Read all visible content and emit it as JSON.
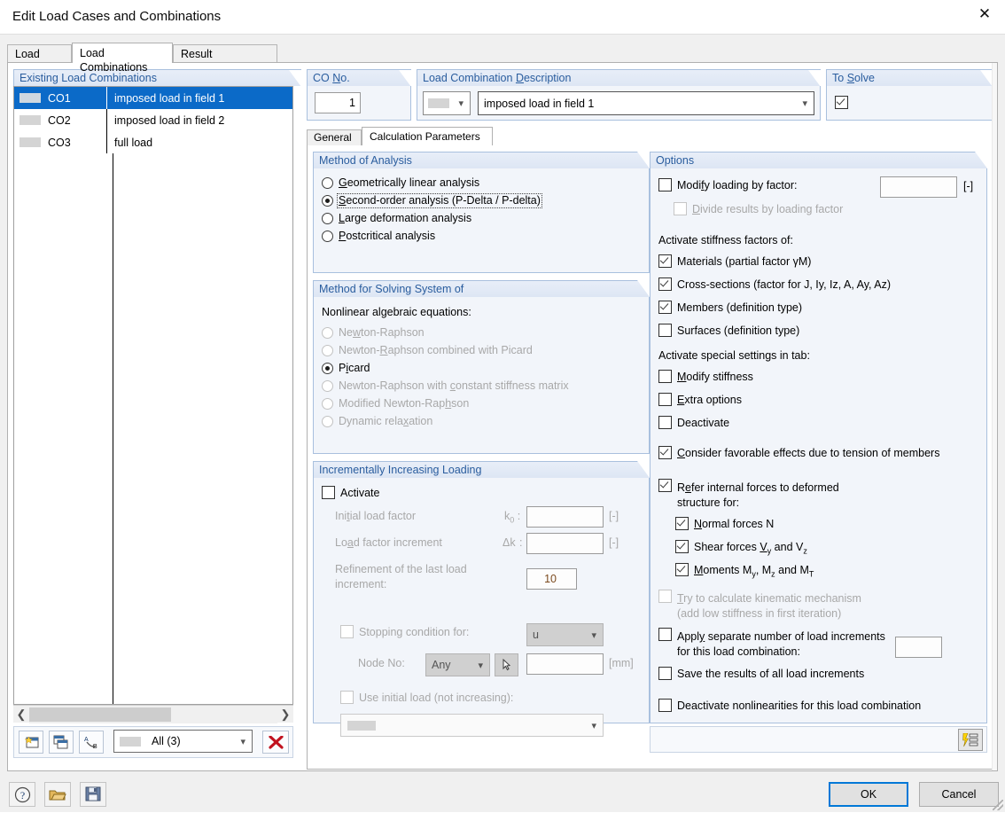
{
  "window": {
    "title": "Edit Load Cases and Combinations",
    "close_icon": "close-icon"
  },
  "tabs": [
    {
      "label": "Load Cases",
      "active": false
    },
    {
      "label": "Load Combinations",
      "active": true
    },
    {
      "label": "Result Combinations",
      "active": false
    }
  ],
  "existing": {
    "title": "Existing Load Combinations",
    "rows": [
      {
        "no": "CO1",
        "desc": "imposed load in field 1",
        "selected": true
      },
      {
        "no": "CO2",
        "desc": "imposed load in field 2",
        "selected": false
      },
      {
        "no": "CO3",
        "desc": "full load",
        "selected": false
      }
    ],
    "filter_value": "All (3)",
    "toolbar": {
      "new_icon": "new-combination-icon",
      "copy_icon": "copy-combination-icon",
      "renumber_icon": "renumber-icon",
      "delete_icon": "delete-red-x-icon"
    }
  },
  "co_no": {
    "title": "CO No.",
    "title_mnemonic": "N",
    "value": "1"
  },
  "description": {
    "title": "Load Combination Description",
    "title_mnemonic": "D",
    "value": "imposed load in field 1",
    "color_swatch": "#d4d4d4"
  },
  "to_solve": {
    "title": "To Solve",
    "title_mnemonic": "S",
    "checked": true
  },
  "inner_tabs": [
    {
      "label": "General",
      "active": false
    },
    {
      "label": "Calculation Parameters",
      "active": true
    }
  ],
  "method_of_analysis": {
    "title": "Method of Analysis",
    "options": [
      {
        "label": "Geometrically linear analysis",
        "mnemonic": "G",
        "selected": false,
        "focused": false
      },
      {
        "label": "Second-order analysis (P-Delta / P-delta)",
        "mnemonic": "S",
        "selected": true,
        "focused": true
      },
      {
        "label": "Large deformation analysis",
        "mnemonic": "L",
        "selected": false,
        "focused": false
      },
      {
        "label": "Postcritical analysis",
        "mnemonic": "P",
        "selected": false,
        "focused": false
      }
    ]
  },
  "method_solving": {
    "title": "Method for Solving System of",
    "subtitle": "Nonlinear algebraic equations:",
    "options": [
      {
        "label": "Newton-Raphson",
        "selected": false,
        "disabled": true
      },
      {
        "label": "Newton-Raphson combined with Picard",
        "selected": false,
        "disabled": true
      },
      {
        "label": "Picard",
        "selected": true,
        "disabled": false
      },
      {
        "label": "Newton-Raphson with constant stiffness matrix",
        "selected": false,
        "disabled": true
      },
      {
        "label": "Modified Newton-Raphson",
        "selected": false,
        "disabled": true
      },
      {
        "label": "Dynamic relaxation",
        "selected": false,
        "disabled": true
      }
    ]
  },
  "incremental": {
    "title": "Incrementally Increasing Loading",
    "activate": {
      "label": "Activate",
      "checked": false
    },
    "initial_load_factor": {
      "label": "Initial load factor",
      "symbol": "k",
      "symbol_sub": "0",
      "value": "",
      "unit": "[-]"
    },
    "load_factor_increment": {
      "label": "Load factor increment",
      "symbol": "Δk",
      "value": "",
      "unit": "[-]"
    },
    "refinement": {
      "label": "Refinement of the last load increment:",
      "value": "10"
    },
    "stopping_condition": {
      "label": "Stopping condition for:",
      "checked": false,
      "select_value": "u"
    },
    "node_no": {
      "label": "Node No:",
      "select_value": "Any",
      "pick_icon": "pick-node-icon",
      "value": "",
      "unit": "[mm]"
    },
    "use_initial_load": {
      "label": "Use initial load (not increasing):",
      "checked": false,
      "select_value": ""
    }
  },
  "options": {
    "title": "Options",
    "modify_loading": {
      "label": "Modify loading by factor:",
      "mnemonic": "f",
      "checked": false,
      "value": "",
      "unit": "[-]"
    },
    "divide_results": {
      "label": "Divide results by loading factor",
      "mnemonic": "D",
      "checked": false,
      "disabled": true
    },
    "stiffness_header": "Activate stiffness factors of:",
    "stiffness": [
      {
        "label": "Materials (partial factor γM)",
        "checked": true
      },
      {
        "label": "Cross-sections (factor for J, Iy, Iz, A, Ay, Az)",
        "checked": true
      },
      {
        "label": "Members (definition type)",
        "checked": true
      },
      {
        "label": "Surfaces (definition type)",
        "checked": false
      }
    ],
    "special_header": "Activate special settings in tab:",
    "special": [
      {
        "label": "Modify stiffness",
        "mnemonic": "M",
        "checked": false
      },
      {
        "label": "Extra options",
        "mnemonic": "E",
        "checked": false
      },
      {
        "label": "Deactivate",
        "checked": false
      }
    ],
    "favorable": {
      "label": "Consider favorable effects due to tension of members",
      "mnemonic": "C",
      "checked": true
    },
    "refer_internal": {
      "label_line1": "Refer internal forces to deformed",
      "label_line2": "structure for:",
      "checked": true
    },
    "refer_sub": [
      {
        "label": "Normal forces N",
        "checked": true
      },
      {
        "label": "Shear forces Vy and Vz",
        "checked": true
      },
      {
        "label": "Moments My, Mz and MT",
        "checked": true
      }
    ],
    "kinematic": {
      "label_line1": "Try to calculate kinematic mechanism",
      "label_line2": "(add low stiffness in first iteration)",
      "checked": false,
      "disabled": true
    },
    "separate_increments": {
      "label_line1": "Apply separate number of load increments",
      "label_line2": "for this load combination:",
      "checked": false,
      "value": ""
    },
    "save_results": {
      "label": "Save the results of all load increments",
      "checked": false
    },
    "deactivate_nonlin": {
      "label": "Deactivate nonlinearities for this load combination",
      "checked": false
    },
    "settings_icon": "calculation-settings-icon"
  },
  "footer": {
    "help_icon": "help-icon",
    "open_icon": "open-folder-icon",
    "save_icon": "save-disk-icon",
    "ok_label": "OK",
    "cancel_label": "Cancel"
  }
}
